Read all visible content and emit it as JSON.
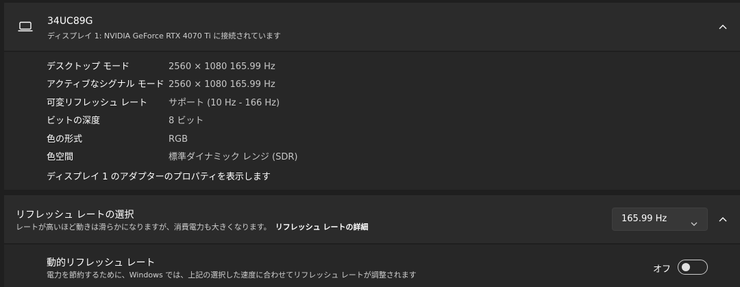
{
  "display": {
    "name": "34UC89G",
    "subtitle": "ディスプレイ 1: NVIDIA GeForce RTX 4070 Ti に接続されています",
    "icon": "laptop-icon",
    "expanded": true
  },
  "details": {
    "rows": [
      {
        "label": "デスクトップ モード",
        "value": "2560 × 1080 165.99 Hz"
      },
      {
        "label": "アクティブなシグナル モード",
        "value": "2560 × 1080 165.99 Hz"
      },
      {
        "label": "可変リフレッシュ レート",
        "value": "サポート (10 Hz - 166 Hz)"
      },
      {
        "label": "ビットの深度",
        "value": "8 ビット"
      },
      {
        "label": "色の形式",
        "value": "RGB"
      },
      {
        "label": "色空間",
        "value": "標準ダイナミック レンジ (SDR)"
      }
    ],
    "adapter_link": "ディスプレイ 1 のアダプターのプロパティを表示します"
  },
  "refresh": {
    "title": "リフレッシュ レートの選択",
    "description": "レートが高いほど動きは滑らかになりますが、消費電力も大きくなります。",
    "detail_link": "リフレッシュ レートの詳細",
    "selected": "165.99 Hz",
    "expanded": true
  },
  "dynamic": {
    "title": "動的リフレッシュ レート",
    "description": "電力を節約するために、Windows では、上記の選択した速度に合わせてリフレッシュ レートが調整されます",
    "state_label": "オフ",
    "on": false
  }
}
